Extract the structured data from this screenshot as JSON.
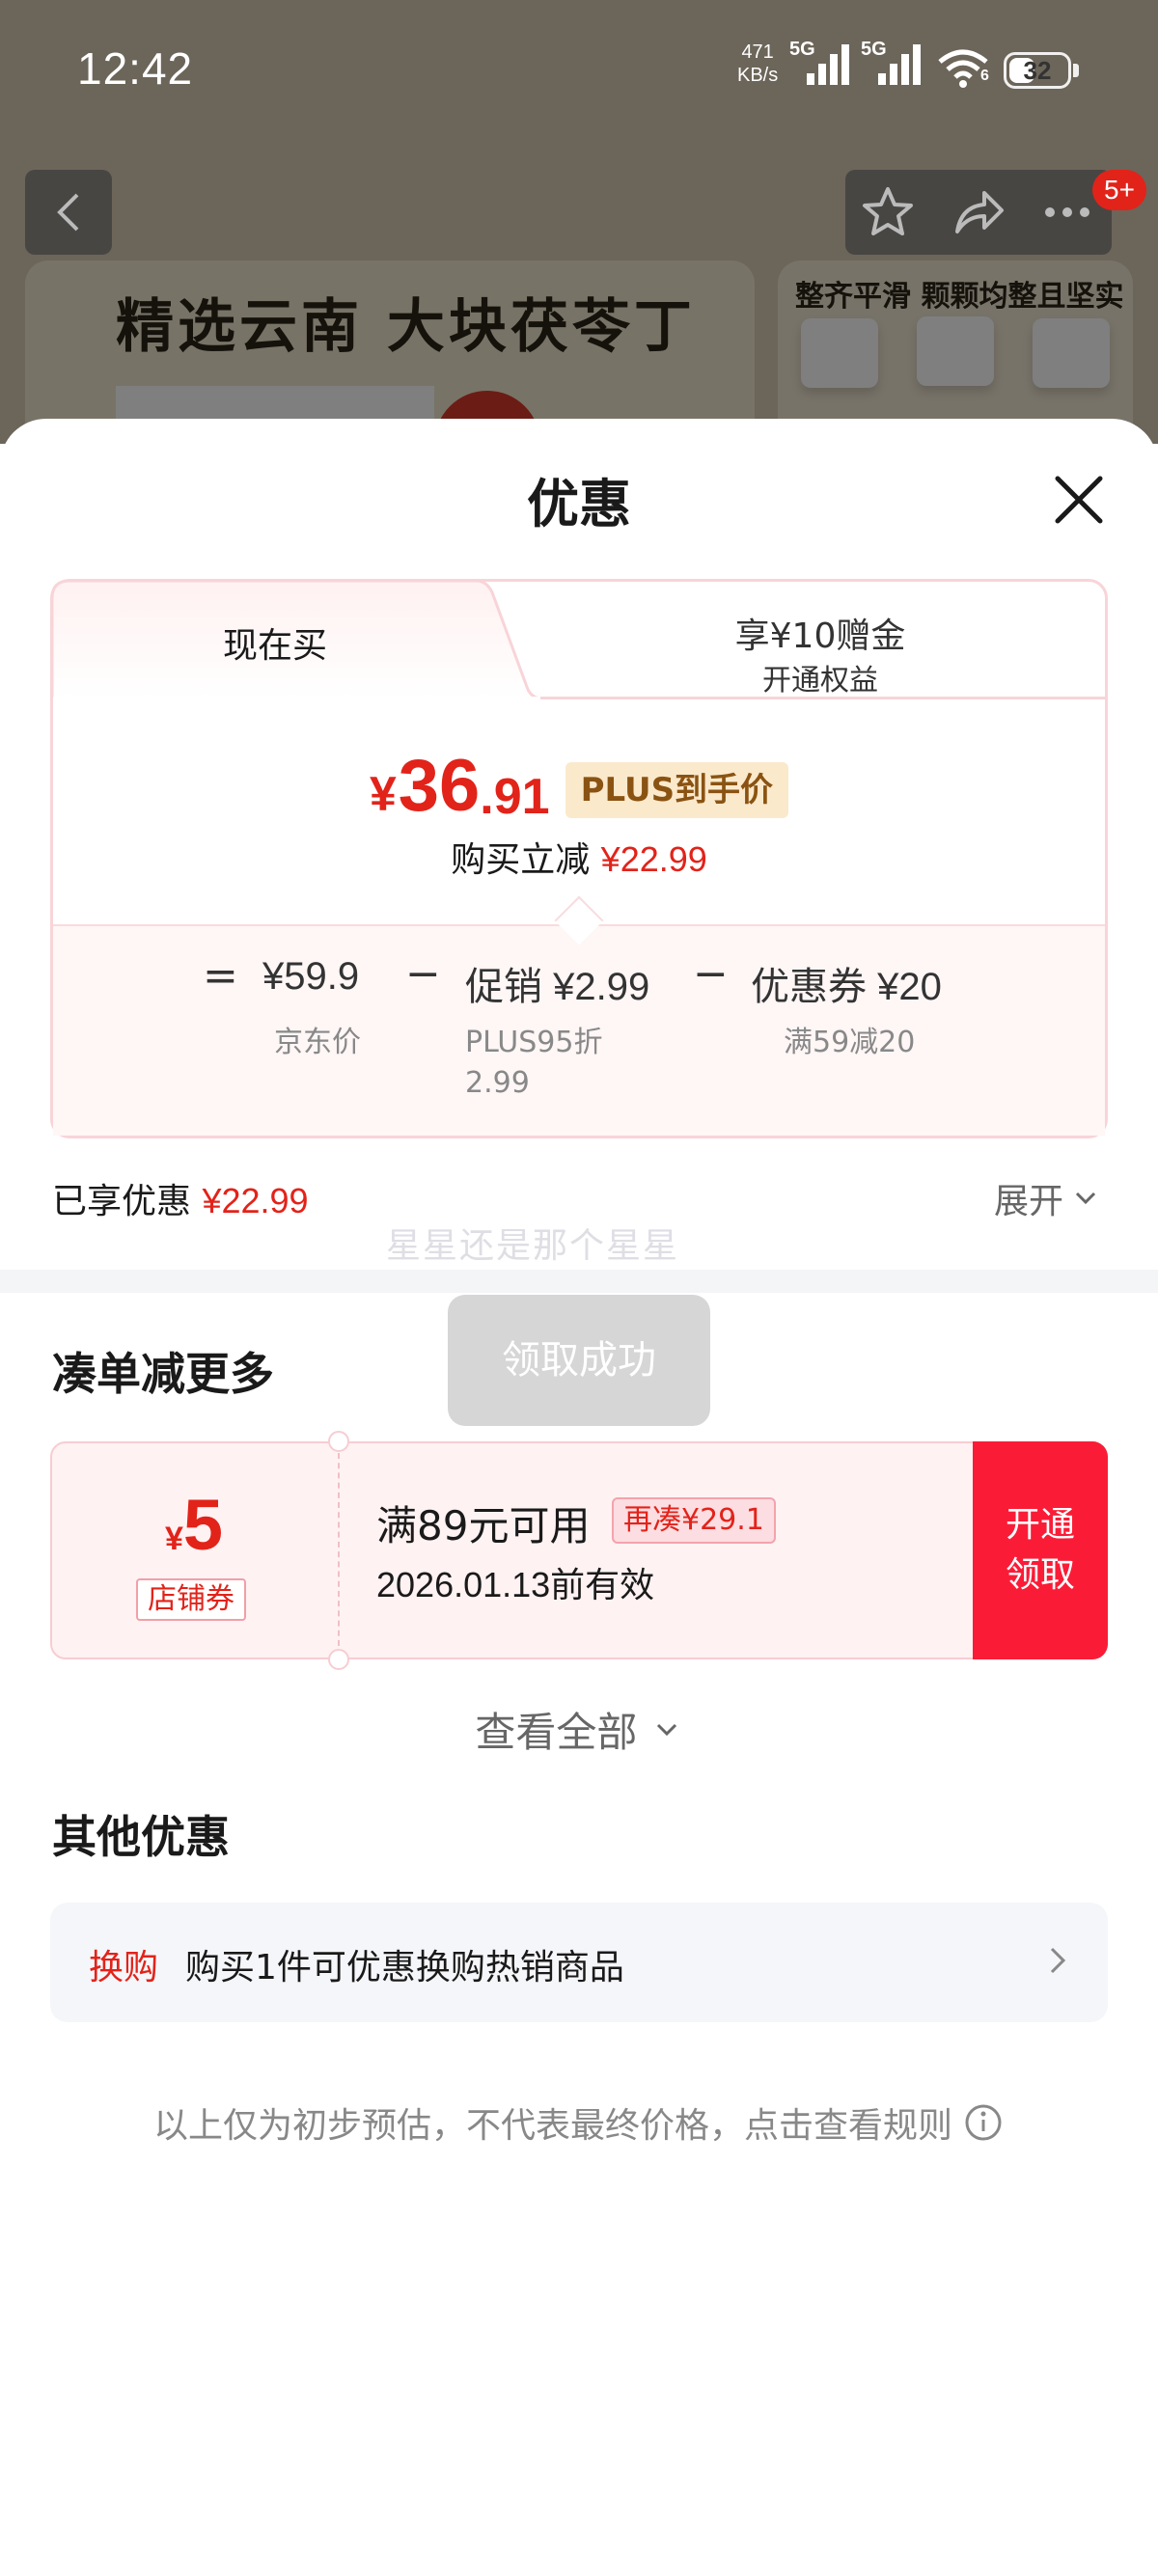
{
  "status_bar": {
    "time": "12:42",
    "net_speed_value": "471",
    "net_speed_unit": "KB/s",
    "signal1_label": "5G",
    "signal2_label": "5G",
    "wifi_label": "6",
    "battery": "32"
  },
  "background": {
    "banner_title": "精选云南  大块茯苓丁",
    "banner_right_text": "整齐平滑  颗颗均整且坚实",
    "badge": "5+"
  },
  "sheet": {
    "title": "优惠"
  },
  "tabs": {
    "active_label": "现在买",
    "other_label_line1": "享¥10赠金",
    "other_label_line2": "开通权益"
  },
  "price": {
    "currency": "¥",
    "integer": "36",
    "decimal": ".91",
    "tag": "PLUS到手价",
    "reduce_label": "购买立减",
    "reduce_value": "¥22.99"
  },
  "breakdown": {
    "equals": "=",
    "item1_value": "¥59.9",
    "item1_sub": "京东价",
    "minus": "−",
    "item2_value": "促销 ¥2.99",
    "item2_sub_line1": "PLUS95折",
    "item2_sub_line2": "2.99",
    "item3_value": "优惠券 ¥20",
    "item3_sub": "满59减20"
  },
  "enjoyed": {
    "label": "已享优惠",
    "value": "¥22.99",
    "expand_label": "展开"
  },
  "ghost_text": "星星还是那个星星",
  "toast": "领取成功",
  "bundle": {
    "title": "凑单减更多",
    "coupon": {
      "currency": "¥",
      "amount": "5",
      "type": "店铺券",
      "condition": "满89元可用",
      "more": "再凑¥29.1",
      "valid": "2026.01.13前有效",
      "button_line1": "开通",
      "button_line2": "领取"
    },
    "view_all": "查看全部"
  },
  "other": {
    "title": "其他优惠",
    "exchange_tag": "换购",
    "exchange_text": "购买1件可优惠换购热销商品"
  },
  "disclaimer": "以上仅为初步预估，不代表最终价格，点击查看规则",
  "colors": {
    "accent_red": "#e2231a",
    "button_red": "#fa1c37",
    "plus_tag_bg": "#fbe9cc"
  },
  "icons": [
    "back-arrow-icon",
    "star-icon",
    "share-icon",
    "more-icon",
    "close-icon",
    "chevron-down-icon",
    "chevron-right-icon",
    "info-icon",
    "signal-icon",
    "wifi-icon",
    "battery-icon"
  ]
}
